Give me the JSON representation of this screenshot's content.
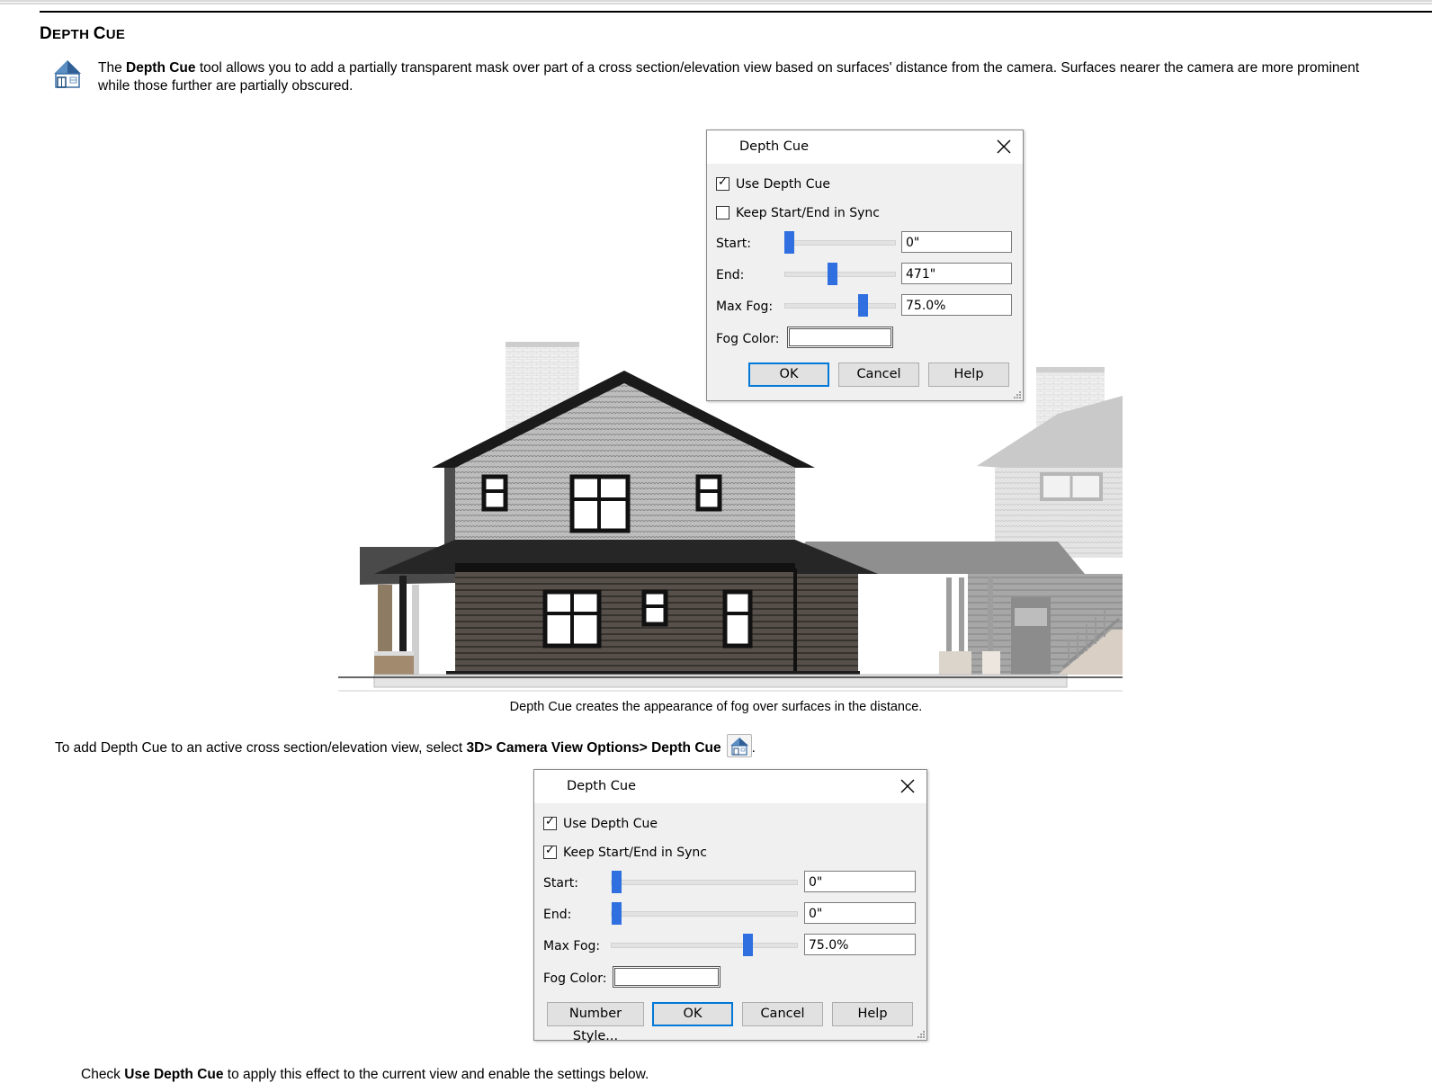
{
  "page": {
    "heading_first": "D",
    "heading_rest": "EPTH ",
    "heading_first2": "C",
    "heading_rest2": "UE",
    "intro_the": "The ",
    "intro_bold": "Depth Cue",
    "intro_text": " tool allows you to add a partially transparent mask over part of a cross section/elevation view based on surfaces' distance from the camera. Surfaces nearer the camera are more prominent while those further are partially obscured.",
    "caption": "Depth Cue creates the appearance of fog over surfaces in the distance.",
    "para_text": "To add Depth Cue to an active cross section/elevation view, select ",
    "para_bold": "3D> Camera View Options> Depth Cue",
    "para_end": ".",
    "cut_text_a": "Check ",
    "cut_bold": "Use Depth Cue",
    "cut_text_b": " to apply this effect to the current view and enable the settings below."
  },
  "dialog1": {
    "title": "Depth Cue",
    "use_depth_cue": {
      "label": "Use Depth Cue",
      "checked": true
    },
    "keep_sync": {
      "label": "Keep Start/End in Sync",
      "checked": false
    },
    "start": {
      "label": "Start:",
      "value": "0\"",
      "slider": 0.0
    },
    "end": {
      "label": "End:",
      "value": "471\"",
      "slider": 0.4
    },
    "max_fog": {
      "label": "Max Fog:",
      "value": "75.0%",
      "slider": 0.75
    },
    "fog_color": {
      "label": "Fog Color:",
      "color": "#ffffff"
    },
    "ok": "OK",
    "cancel": "Cancel",
    "help": "Help"
  },
  "dialog2": {
    "title": "Depth Cue",
    "use_depth_cue": {
      "label": "Use Depth Cue",
      "checked": true
    },
    "keep_sync": {
      "label": "Keep Start/End in Sync",
      "checked": true
    },
    "start": {
      "label": "Start:",
      "value": "0\"",
      "slider": 0.0
    },
    "end": {
      "label": "End:",
      "value": "0\"",
      "slider": 0.0
    },
    "max_fog": {
      "label": "Max Fog:",
      "value": "75.0%",
      "slider": 0.75
    },
    "fog_color": {
      "label": "Fog Color:",
      "color": "#ffffff"
    },
    "number_style": "Number Style...",
    "ok": "OK",
    "cancel": "Cancel",
    "help": "Help"
  },
  "icons": {
    "intro": "depth-cue-house-icon",
    "inline": "depth-cue-house-icon",
    "close": "close-icon"
  },
  "colors": {
    "accent": "#2f6fe0",
    "default_button_border": "#0078d7"
  }
}
